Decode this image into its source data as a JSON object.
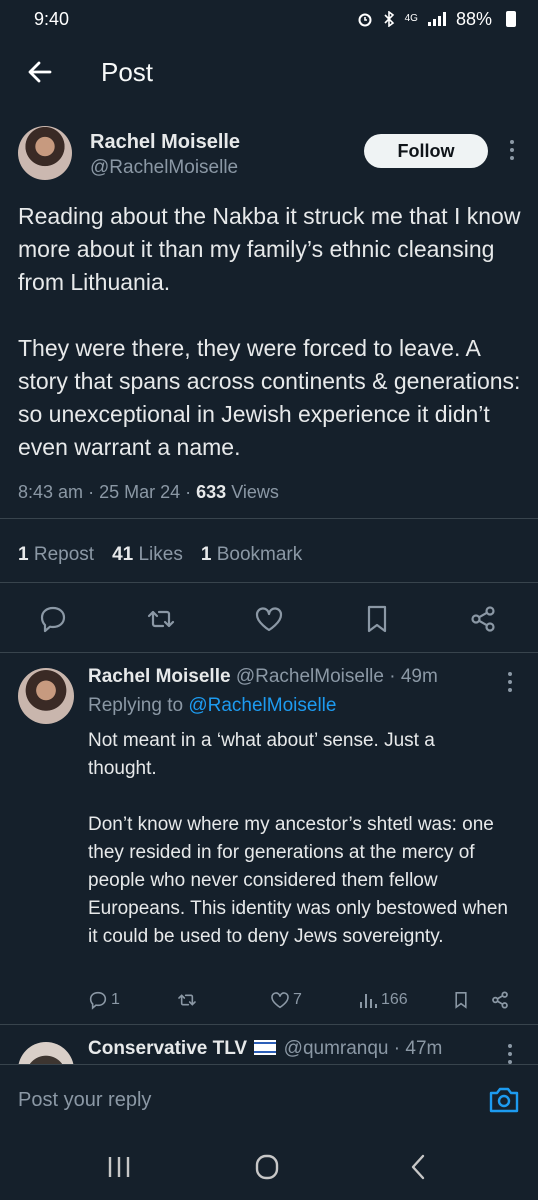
{
  "status_bar": {
    "time": "9:40",
    "network": "4G",
    "battery": "88%"
  },
  "header": {
    "title": "Post",
    "back_icon": "arrow-left-icon"
  },
  "post": {
    "author_name": "Rachel Moiselle",
    "author_handle": "@RachelMoiselle",
    "follow_label": "Follow",
    "text": "Reading about the Nakba it struck me that I know more about it than my family’s ethnic cleansing from Lithuania.\n\nThey were there, they were forced to leave. A story that spans across continents & generations: so unexceptional in Jewish experience it didn’t even warrant a name.",
    "time": "8:43 am",
    "date": "25 Mar 24",
    "views_count": "633",
    "views_label": "Views",
    "reposts_count": "1",
    "reposts_label": "Repost",
    "likes_count": "41",
    "likes_label": "Likes",
    "bookmarks_count": "1",
    "bookmarks_label": "Bookmark"
  },
  "reply": {
    "author_name": "Rachel Moiselle",
    "author_handle": "@RachelMoiselle",
    "age": "49m",
    "replying_prefix": "Replying to",
    "replying_handle": "@RachelMoiselle",
    "text": "Not meant in a ‘what about’ sense. Just a thought.\n\nDon’t know where my ancestor’s shtetl was: one they resided in for generations at the mercy of people who never considered them fellow Europeans. This identity was only bestowed when it could be used to deny Jews sovereignty.",
    "reply_count": "1",
    "like_count": "7",
    "view_count": "166"
  },
  "next_reply": {
    "author_name": "Conservative TLV",
    "author_handle": "@qumranqu",
    "age": "47m"
  },
  "composer": {
    "placeholder": "Post your reply"
  },
  "colors": {
    "background": "#15202b",
    "text": "#e7e9ea",
    "muted": "#8b98a5",
    "link": "#1d9bf0",
    "divider": "#38444d"
  }
}
